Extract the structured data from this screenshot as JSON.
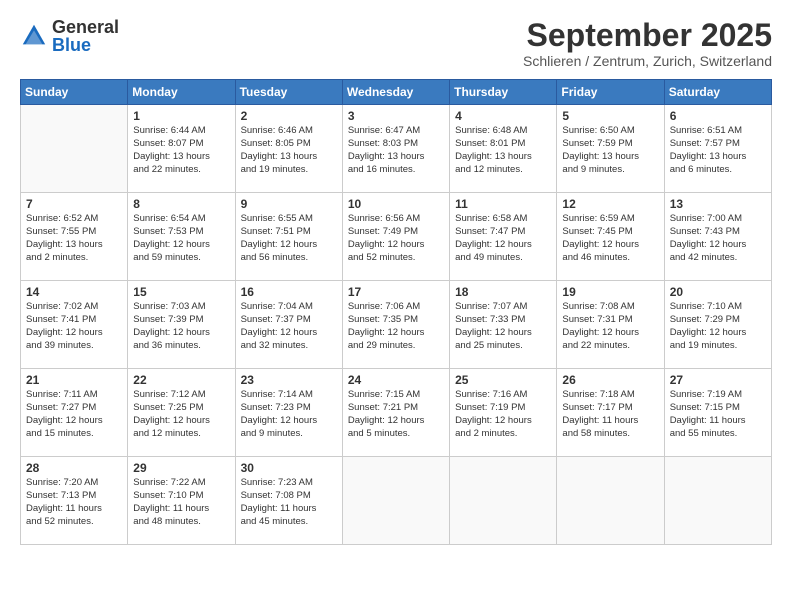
{
  "header": {
    "logo_general": "General",
    "logo_blue": "Blue",
    "month_title": "September 2025",
    "location": "Schlieren / Zentrum, Zurich, Switzerland"
  },
  "days_of_week": [
    "Sunday",
    "Monday",
    "Tuesday",
    "Wednesday",
    "Thursday",
    "Friday",
    "Saturday"
  ],
  "weeks": [
    [
      {
        "day": "",
        "info": ""
      },
      {
        "day": "1",
        "info": "Sunrise: 6:44 AM\nSunset: 8:07 PM\nDaylight: 13 hours\nand 22 minutes."
      },
      {
        "day": "2",
        "info": "Sunrise: 6:46 AM\nSunset: 8:05 PM\nDaylight: 13 hours\nand 19 minutes."
      },
      {
        "day": "3",
        "info": "Sunrise: 6:47 AM\nSunset: 8:03 PM\nDaylight: 13 hours\nand 16 minutes."
      },
      {
        "day": "4",
        "info": "Sunrise: 6:48 AM\nSunset: 8:01 PM\nDaylight: 13 hours\nand 12 minutes."
      },
      {
        "day": "5",
        "info": "Sunrise: 6:50 AM\nSunset: 7:59 PM\nDaylight: 13 hours\nand 9 minutes."
      },
      {
        "day": "6",
        "info": "Sunrise: 6:51 AM\nSunset: 7:57 PM\nDaylight: 13 hours\nand 6 minutes."
      }
    ],
    [
      {
        "day": "7",
        "info": "Sunrise: 6:52 AM\nSunset: 7:55 PM\nDaylight: 13 hours\nand 2 minutes."
      },
      {
        "day": "8",
        "info": "Sunrise: 6:54 AM\nSunset: 7:53 PM\nDaylight: 12 hours\nand 59 minutes."
      },
      {
        "day": "9",
        "info": "Sunrise: 6:55 AM\nSunset: 7:51 PM\nDaylight: 12 hours\nand 56 minutes."
      },
      {
        "day": "10",
        "info": "Sunrise: 6:56 AM\nSunset: 7:49 PM\nDaylight: 12 hours\nand 52 minutes."
      },
      {
        "day": "11",
        "info": "Sunrise: 6:58 AM\nSunset: 7:47 PM\nDaylight: 12 hours\nand 49 minutes."
      },
      {
        "day": "12",
        "info": "Sunrise: 6:59 AM\nSunset: 7:45 PM\nDaylight: 12 hours\nand 46 minutes."
      },
      {
        "day": "13",
        "info": "Sunrise: 7:00 AM\nSunset: 7:43 PM\nDaylight: 12 hours\nand 42 minutes."
      }
    ],
    [
      {
        "day": "14",
        "info": "Sunrise: 7:02 AM\nSunset: 7:41 PM\nDaylight: 12 hours\nand 39 minutes."
      },
      {
        "day": "15",
        "info": "Sunrise: 7:03 AM\nSunset: 7:39 PM\nDaylight: 12 hours\nand 36 minutes."
      },
      {
        "day": "16",
        "info": "Sunrise: 7:04 AM\nSunset: 7:37 PM\nDaylight: 12 hours\nand 32 minutes."
      },
      {
        "day": "17",
        "info": "Sunrise: 7:06 AM\nSunset: 7:35 PM\nDaylight: 12 hours\nand 29 minutes."
      },
      {
        "day": "18",
        "info": "Sunrise: 7:07 AM\nSunset: 7:33 PM\nDaylight: 12 hours\nand 25 minutes."
      },
      {
        "day": "19",
        "info": "Sunrise: 7:08 AM\nSunset: 7:31 PM\nDaylight: 12 hours\nand 22 minutes."
      },
      {
        "day": "20",
        "info": "Sunrise: 7:10 AM\nSunset: 7:29 PM\nDaylight: 12 hours\nand 19 minutes."
      }
    ],
    [
      {
        "day": "21",
        "info": "Sunrise: 7:11 AM\nSunset: 7:27 PM\nDaylight: 12 hours\nand 15 minutes."
      },
      {
        "day": "22",
        "info": "Sunrise: 7:12 AM\nSunset: 7:25 PM\nDaylight: 12 hours\nand 12 minutes."
      },
      {
        "day": "23",
        "info": "Sunrise: 7:14 AM\nSunset: 7:23 PM\nDaylight: 12 hours\nand 9 minutes."
      },
      {
        "day": "24",
        "info": "Sunrise: 7:15 AM\nSunset: 7:21 PM\nDaylight: 12 hours\nand 5 minutes."
      },
      {
        "day": "25",
        "info": "Sunrise: 7:16 AM\nSunset: 7:19 PM\nDaylight: 12 hours\nand 2 minutes."
      },
      {
        "day": "26",
        "info": "Sunrise: 7:18 AM\nSunset: 7:17 PM\nDaylight: 11 hours\nand 58 minutes."
      },
      {
        "day": "27",
        "info": "Sunrise: 7:19 AM\nSunset: 7:15 PM\nDaylight: 11 hours\nand 55 minutes."
      }
    ],
    [
      {
        "day": "28",
        "info": "Sunrise: 7:20 AM\nSunset: 7:13 PM\nDaylight: 11 hours\nand 52 minutes."
      },
      {
        "day": "29",
        "info": "Sunrise: 7:22 AM\nSunset: 7:10 PM\nDaylight: 11 hours\nand 48 minutes."
      },
      {
        "day": "30",
        "info": "Sunrise: 7:23 AM\nSunset: 7:08 PM\nDaylight: 11 hours\nand 45 minutes."
      },
      {
        "day": "",
        "info": ""
      },
      {
        "day": "",
        "info": ""
      },
      {
        "day": "",
        "info": ""
      },
      {
        "day": "",
        "info": ""
      }
    ]
  ]
}
